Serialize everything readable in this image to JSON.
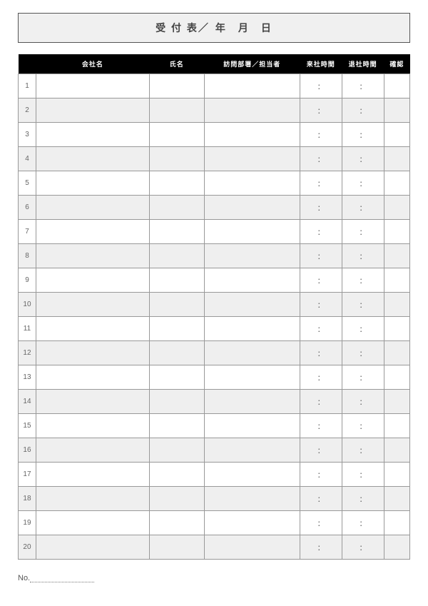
{
  "header": {
    "title": "受 付 表／",
    "date_labels": "年　月　日"
  },
  "columns": {
    "num": "",
    "company": "会社名",
    "name": "氏名",
    "dept": "訪問部署／担当者",
    "time_in": "来社時間",
    "time_out": "退社時間",
    "confirm": "確認"
  },
  "rows": [
    {
      "n": "1",
      "company": "",
      "name": "",
      "dept": "",
      "tin": "：",
      "tout": "：",
      "conf": ""
    },
    {
      "n": "2",
      "company": "",
      "name": "",
      "dept": "",
      "tin": "：",
      "tout": "：",
      "conf": ""
    },
    {
      "n": "3",
      "company": "",
      "name": "",
      "dept": "",
      "tin": "：",
      "tout": "：",
      "conf": ""
    },
    {
      "n": "4",
      "company": "",
      "name": "",
      "dept": "",
      "tin": "：",
      "tout": "：",
      "conf": ""
    },
    {
      "n": "5",
      "company": "",
      "name": "",
      "dept": "",
      "tin": "：",
      "tout": "：",
      "conf": ""
    },
    {
      "n": "6",
      "company": "",
      "name": "",
      "dept": "",
      "tin": "：",
      "tout": "：",
      "conf": ""
    },
    {
      "n": "7",
      "company": "",
      "name": "",
      "dept": "",
      "tin": "：",
      "tout": "：",
      "conf": ""
    },
    {
      "n": "8",
      "company": "",
      "name": "",
      "dept": "",
      "tin": "：",
      "tout": "：",
      "conf": ""
    },
    {
      "n": "9",
      "company": "",
      "name": "",
      "dept": "",
      "tin": "：",
      "tout": "：",
      "conf": ""
    },
    {
      "n": "10",
      "company": "",
      "name": "",
      "dept": "",
      "tin": "：",
      "tout": "：",
      "conf": ""
    },
    {
      "n": "11",
      "company": "",
      "name": "",
      "dept": "",
      "tin": "：",
      "tout": "：",
      "conf": ""
    },
    {
      "n": "12",
      "company": "",
      "name": "",
      "dept": "",
      "tin": "：",
      "tout": "：",
      "conf": ""
    },
    {
      "n": "13",
      "company": "",
      "name": "",
      "dept": "",
      "tin": "：",
      "tout": "：",
      "conf": ""
    },
    {
      "n": "14",
      "company": "",
      "name": "",
      "dept": "",
      "tin": "：",
      "tout": "：",
      "conf": ""
    },
    {
      "n": "15",
      "company": "",
      "name": "",
      "dept": "",
      "tin": "：",
      "tout": "：",
      "conf": ""
    },
    {
      "n": "16",
      "company": "",
      "name": "",
      "dept": "",
      "tin": "：",
      "tout": "：",
      "conf": ""
    },
    {
      "n": "17",
      "company": "",
      "name": "",
      "dept": "",
      "tin": "：",
      "tout": "：",
      "conf": ""
    },
    {
      "n": "18",
      "company": "",
      "name": "",
      "dept": "",
      "tin": "：",
      "tout": "：",
      "conf": ""
    },
    {
      "n": "19",
      "company": "",
      "name": "",
      "dept": "",
      "tin": "：",
      "tout": "：",
      "conf": ""
    },
    {
      "n": "20",
      "company": "",
      "name": "",
      "dept": "",
      "tin": "：",
      "tout": "：",
      "conf": ""
    }
  ],
  "footer": {
    "no_label": "No."
  }
}
